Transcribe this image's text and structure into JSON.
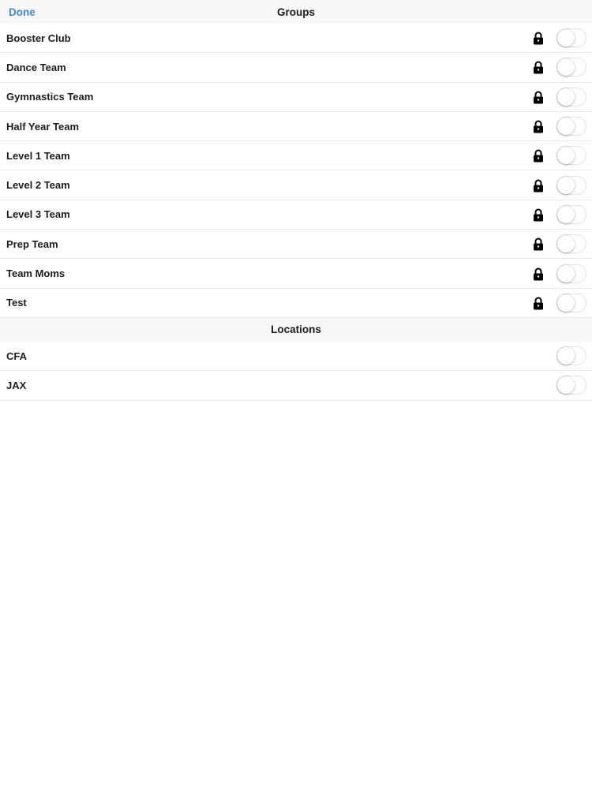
{
  "header": {
    "done_label": "Done",
    "groups_title": "Groups",
    "locations_title": "Locations"
  },
  "colors": {
    "accent": "#3f86cf",
    "header_bg": "#f7f7f8",
    "separator": "#e9e9ec"
  },
  "groups": [
    {
      "label": "Booster Club",
      "locked": true,
      "enabled": false
    },
    {
      "label": "Dance Team",
      "locked": true,
      "enabled": false
    },
    {
      "label": "Gymnastics Team",
      "locked": true,
      "enabled": false
    },
    {
      "label": "Half Year Team",
      "locked": true,
      "enabled": false
    },
    {
      "label": "Level 1 Team",
      "locked": true,
      "enabled": false
    },
    {
      "label": "Level 2 Team",
      "locked": true,
      "enabled": false
    },
    {
      "label": "Level 3 Team",
      "locked": true,
      "enabled": false
    },
    {
      "label": "Prep Team",
      "locked": true,
      "enabled": false
    },
    {
      "label": "Team Moms",
      "locked": true,
      "enabled": false
    },
    {
      "label": "Test",
      "locked": true,
      "enabled": false
    }
  ],
  "locations": [
    {
      "label": "CFA",
      "locked": false,
      "enabled": false
    },
    {
      "label": "JAX",
      "locked": false,
      "enabled": false
    }
  ],
  "icons": {
    "lock": "lock-icon"
  }
}
